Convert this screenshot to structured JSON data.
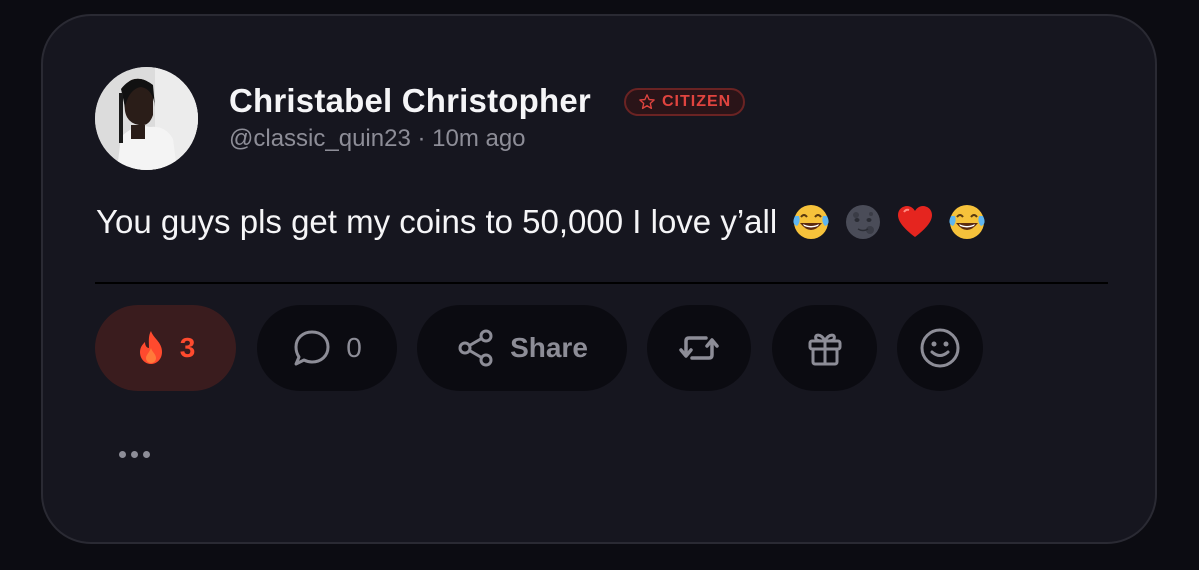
{
  "post": {
    "author_name": "Christabel Christopher",
    "badge_label": "CITIZEN",
    "handle_time": "@classic_quin23 · 10m ago",
    "text": "You guys pls get my coins to 50,000 I love y’all",
    "emojis": [
      "😂",
      "🌚",
      "❤️",
      "😂"
    ]
  },
  "actions": {
    "fire_count": "3",
    "comment_count": "0",
    "share_label": "Share"
  },
  "icons": {
    "badge": "star-outline-icon",
    "fire": "fire-icon",
    "comment": "speech-bubble-icon",
    "share": "share-nodes-icon",
    "repost": "repost-icon",
    "gift": "gift-icon",
    "react": "smiley-icon",
    "more": "more-dots-icon"
  },
  "colors": {
    "accent": "#e0443f",
    "fire": "#ff4a2e",
    "background": "#16161f"
  }
}
